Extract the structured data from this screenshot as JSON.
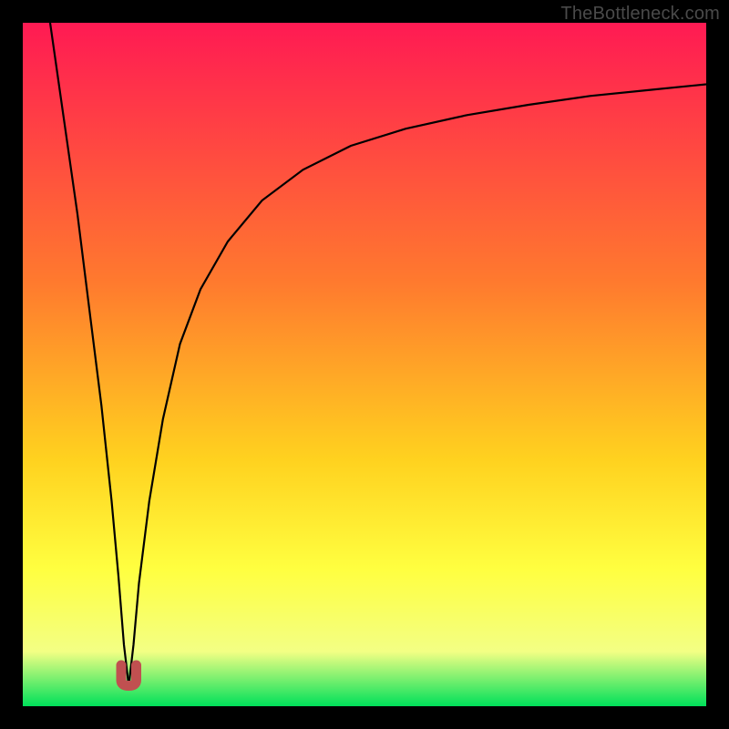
{
  "watermark": "TheBottleneck.com",
  "gradient": {
    "top": "#ff1a53",
    "mid1": "#ff7a2e",
    "mid2": "#ffd21f",
    "mid3": "#ffff40",
    "mid4": "#f3ff84",
    "bottom": "#00e05a"
  },
  "chart_data": {
    "type": "line",
    "title": "",
    "xlabel": "",
    "ylabel": "",
    "xlim": [
      0,
      100
    ],
    "ylim": [
      0,
      100
    ],
    "x_min_marker": 15.5,
    "series": [
      {
        "name": "left-branch",
        "x": [
          4.0,
          6.0,
          8.0,
          10.0,
          11.5,
          13.0,
          14.0,
          14.8,
          15.5
        ],
        "values": [
          100,
          86,
          72,
          56,
          44,
          30,
          19,
          9,
          3
        ]
      },
      {
        "name": "right-branch",
        "x": [
          15.5,
          16.2,
          17.0,
          18.5,
          20.5,
          23.0,
          26.0,
          30.0,
          35.0,
          41.0,
          48.0,
          56.0,
          65.0,
          74.0,
          83.0,
          92.0,
          100.0
        ],
        "values": [
          3,
          9,
          18,
          30,
          42,
          53,
          61,
          68,
          74,
          78.5,
          82,
          84.5,
          86.5,
          88,
          89.3,
          90.2,
          91
        ]
      }
    ],
    "marker": {
      "name": "minimum-u-marker",
      "shape": "U",
      "x_range": [
        14.4,
        16.6
      ],
      "y_range": [
        3,
        6
      ]
    }
  }
}
